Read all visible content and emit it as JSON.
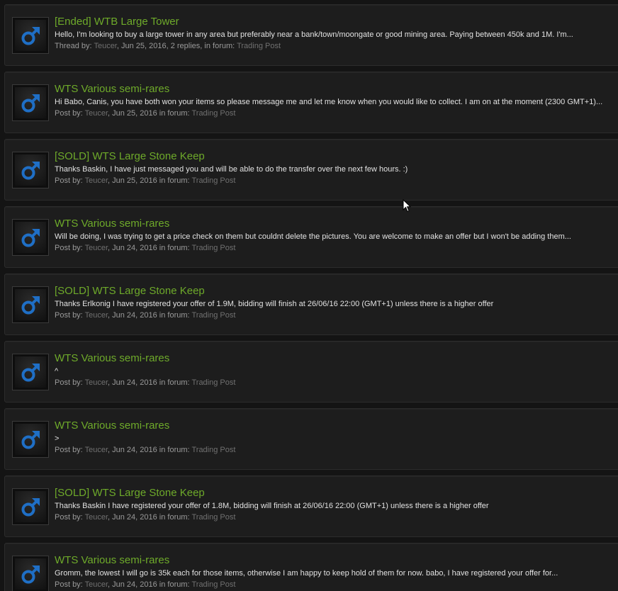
{
  "colors": {
    "background": "#141414",
    "row_background": "#1d1d1d",
    "title_link": "#6eaa2a",
    "snippet_text": "#e2e2e2",
    "meta_label": "#9a9a9a",
    "meta_link": "#707070",
    "avatar_symbol": "#1f6fc6"
  },
  "avatar_icon": "male-symbol-icon",
  "results": [
    {
      "title": "[Ended] WTB Large Tower",
      "snippet": "Hello, I'm looking to buy a large tower in any area but preferably near a bank/town/moongate or good mining area. Paying between 450k and 1M. I'm...",
      "by_label": "Thread by:",
      "author": "Teucer",
      "details": ", Jun 25, 2016, 2 replies, in forum:",
      "forum": "Trading Post"
    },
    {
      "title": "WTS Various semi-rares",
      "snippet": "Hi Babo, Canis, you have both won your items so please message me and let me know when you would like to collect. I am on at the moment (2300 GMT+1)...",
      "by_label": "Post by:",
      "author": "Teucer",
      "details": ", Jun 25, 2016 in forum:",
      "forum": "Trading Post"
    },
    {
      "title": "[SOLD] WTS Large Stone Keep",
      "snippet": "Thanks Baskin, I have just messaged you and will be able to do the transfer over the next few hours. :)",
      "by_label": "Post by:",
      "author": "Teucer",
      "details": ", Jun 25, 2016 in forum:",
      "forum": "Trading Post"
    },
    {
      "title": "WTS Various semi-rares",
      "snippet": "Will be doing, I was trying to get a price check on them but couldnt delete the pictures. You are welcome to make an offer but I won't be adding them...",
      "by_label": "Post by:",
      "author": "Teucer",
      "details": ", Jun 24, 2016 in forum:",
      "forum": "Trading Post"
    },
    {
      "title": "[SOLD] WTS Large Stone Keep",
      "snippet": "Thanks Erlkonig I have registered your offer of 1.9M, bidding will finish at 26/06/16 22:00 (GMT+1) unless there is a higher offer",
      "by_label": "Post by:",
      "author": "Teucer",
      "details": ", Jun 24, 2016 in forum:",
      "forum": "Trading Post"
    },
    {
      "title": "WTS Various semi-rares",
      "snippet": "^",
      "by_label": "Post by:",
      "author": "Teucer",
      "details": ", Jun 24, 2016 in forum:",
      "forum": "Trading Post"
    },
    {
      "title": "WTS Various semi-rares",
      "snippet": ">",
      "by_label": "Post by:",
      "author": "Teucer",
      "details": ", Jun 24, 2016 in forum:",
      "forum": "Trading Post"
    },
    {
      "title": "[SOLD] WTS Large Stone Keep",
      "snippet": "Thanks Baskin I have registered your offer of 1.8M, bidding will finish at 26/06/16 22:00 (GMT+1) unless there is a higher offer",
      "by_label": "Post by:",
      "author": "Teucer",
      "details": ", Jun 24, 2016 in forum:",
      "forum": "Trading Post"
    },
    {
      "title": "WTS Various semi-rares",
      "snippet": "Gromm, the lowest I will go is 35k each for those items, otherwise I am happy to keep hold of them for now. babo, I have registered your offer for...",
      "by_label": "Post by:",
      "author": "Teucer",
      "details": ", Jun 24, 2016 in forum:",
      "forum": "Trading Post"
    }
  ]
}
